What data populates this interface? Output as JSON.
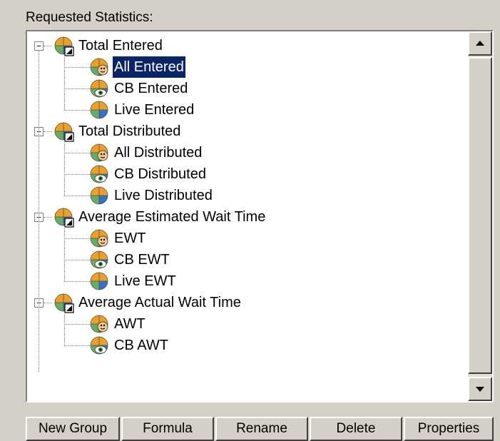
{
  "panel_title": "Requested Statistics:",
  "groups": [
    {
      "label": "Total Entered",
      "children": [
        "All Entered",
        "CB Entered",
        "Live Entered"
      ]
    },
    {
      "label": "Total Distributed",
      "children": [
        "All Distributed",
        "CB Distributed",
        "Live Distributed"
      ]
    },
    {
      "label": "Average Estimated Wait Time",
      "children": [
        "EWT",
        "CB EWT",
        "Live EWT"
      ]
    },
    {
      "label": "Average Actual Wait Time",
      "children": [
        "AWT",
        "CB AWT"
      ]
    }
  ],
  "selected_item": "All Entered",
  "buttons": {
    "new_group": "New Group",
    "formula": "Formula",
    "rename": "Rename",
    "delete": "Delete",
    "properties": "Properties"
  },
  "icons": {
    "group": "group-stat-icon",
    "all": "all-stat-icon",
    "callback": "callback-stat-icon",
    "live": "live-stat-icon"
  },
  "colors": {
    "selection": "#0a246a",
    "pie_orange": "#f0a020",
    "pie_green": "#60b060",
    "pie_blue": "#3070d0"
  }
}
